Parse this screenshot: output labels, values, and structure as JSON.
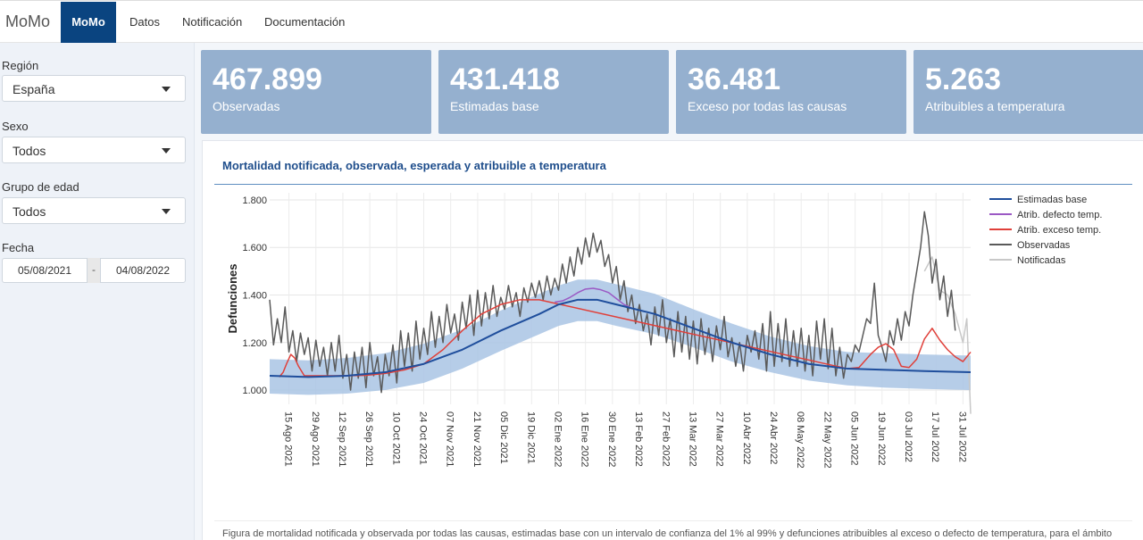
{
  "nav": {
    "brand": "MoMo",
    "items": [
      {
        "label": "MoMo",
        "active": true
      },
      {
        "label": "Datos",
        "active": false
      },
      {
        "label": "Notificación",
        "active": false
      },
      {
        "label": "Documentación",
        "active": false
      }
    ]
  },
  "sidebar": {
    "region_label": "Región",
    "region_value": "España",
    "sexo_label": "Sexo",
    "sexo_value": "Todos",
    "edad_label": "Grupo de edad",
    "edad_value": "Todos",
    "fecha_label": "Fecha",
    "fecha_start": "05/08/2021",
    "fecha_sep": "-",
    "fecha_end": "04/08/2022"
  },
  "value_boxes": [
    {
      "value": "467.899",
      "label": "Observadas",
      "color": "#95b0cf"
    },
    {
      "value": "431.418",
      "label": "Estimadas base",
      "color": "#95b0cf"
    },
    {
      "value": "36.481",
      "label": "Exceso por todas las causas",
      "color": "#95b0cf"
    },
    {
      "value": "5.263",
      "label": "Atribuibles a temperatura",
      "color": "#95b0cf"
    }
  ],
  "panel": {
    "title": "Mortalidad notificada, observada, esperada y atribuible a temperatura",
    "caption": "Figura de mortalidad notificada y observada por todas las causas, estimadas base con un intervalo de confianza del 1% al 99% y defunciones atribuibles al exceso o defecto de temperatura, para el ámbito"
  },
  "colors": {
    "nav_active": "#0a4480",
    "estimadas": "#1f4e9c",
    "band": "#a9c4e4",
    "defecto": "#9b59c4",
    "exceso": "#e0403a",
    "observadas": "#5a5a5a",
    "notificadas": "#c8c8c8"
  },
  "chart_data": {
    "type": "line",
    "ylabel": "Defunciones",
    "yticks": [
      "1.000",
      "1.200",
      "1.400",
      "1.600",
      "1.800"
    ],
    "ytick_values": [
      1000,
      1200,
      1400,
      1600,
      1800
    ],
    "ylim": [
      940,
      1830
    ],
    "x_tick_labels": [
      "15 Ago 2021",
      "29 Ago 2021",
      "12 Sep 2021",
      "26 Sep 2021",
      "10 Oct 2021",
      "24 Oct 2021",
      "07 Nov 2021",
      "21 Nov 2021",
      "05 Dic 2021",
      "19 Dic 2021",
      "02 Ene 2022",
      "16 Ene 2022",
      "30 Ene 2022",
      "13 Feb 2022",
      "27 Feb 2022",
      "13 Mar 2022",
      "27 Mar 2022",
      "10 Abr 2022",
      "24 Abr 2022",
      "08 May 2022",
      "22 May 2022",
      "05 Jun 2022",
      "19 Jun 2022",
      "03 Jul 2022",
      "17 Jul 2022",
      "31 Jul 2022"
    ],
    "x_tick_days": [
      10,
      24,
      38,
      52,
      66,
      80,
      94,
      108,
      122,
      136,
      150,
      164,
      178,
      192,
      206,
      220,
      234,
      248,
      262,
      276,
      290,
      304,
      318,
      332,
      346,
      360
    ],
    "x_range_days": [
      0,
      364
    ],
    "legend": [
      "Estimadas base",
      "Atrib. defecto temp.",
      "Atrib. exceso temp.",
      "Observadas",
      "Notificadas"
    ],
    "legend_position": "right",
    "grid": true,
    "series": [
      {
        "name": "Estimadas base",
        "day": [
          0,
          20,
          40,
          60,
          80,
          100,
          120,
          140,
          150,
          160,
          170,
          180,
          200,
          220,
          240,
          260,
          280,
          300,
          320,
          340,
          364
        ],
        "values": [
          1060,
          1055,
          1060,
          1075,
          1110,
          1170,
          1250,
          1320,
          1360,
          1380,
          1380,
          1360,
          1320,
          1260,
          1200,
          1150,
          1110,
          1090,
          1085,
          1080,
          1075
        ]
      },
      {
        "name": "Band low",
        "day": [
          0,
          20,
          40,
          60,
          80,
          100,
          120,
          140,
          150,
          160,
          170,
          180,
          200,
          220,
          240,
          260,
          280,
          300,
          320,
          340,
          364
        ],
        "values": [
          985,
          980,
          985,
          1000,
          1030,
          1090,
          1165,
          1235,
          1270,
          1290,
          1290,
          1270,
          1235,
          1180,
          1120,
          1075,
          1040,
          1020,
          1010,
          1005,
          1000
        ]
      },
      {
        "name": "Band high",
        "day": [
          0,
          20,
          40,
          60,
          80,
          100,
          120,
          140,
          150,
          160,
          170,
          180,
          200,
          220,
          240,
          260,
          280,
          300,
          320,
          340,
          364
        ],
        "values": [
          1130,
          1125,
          1135,
          1155,
          1195,
          1255,
          1335,
          1405,
          1440,
          1465,
          1465,
          1445,
          1405,
          1340,
          1280,
          1225,
          1185,
          1160,
          1155,
          1150,
          1145
        ]
      },
      {
        "name": "Atrib. exceso temp.",
        "day": [
          5,
          7,
          9,
          11,
          13,
          15,
          18,
          22,
          30,
          40,
          50,
          60,
          70,
          80,
          90,
          100,
          110,
          120,
          130,
          140,
          300,
          306,
          312,
          316,
          320,
          324,
          328,
          332,
          336,
          340,
          344,
          348,
          352,
          356,
          360,
          364
        ],
        "values": [
          1055,
          1075,
          1115,
          1150,
          1135,
          1100,
          1060,
          1060,
          1060,
          1060,
          1062,
          1070,
          1085,
          1110,
          1170,
          1250,
          1320,
          1360,
          1380,
          1380,
          1090,
          1095,
          1150,
          1180,
          1195,
          1170,
          1100,
          1095,
          1130,
          1215,
          1260,
          1210,
          1170,
          1140,
          1120,
          1160
        ]
      },
      {
        "name": "Atrib. defecto temp.",
        "day": [
          148,
          152,
          156,
          160,
          164,
          168,
          172,
          176,
          180,
          184,
          188
        ],
        "values": [
          1370,
          1375,
          1390,
          1410,
          1425,
          1428,
          1422,
          1410,
          1385,
          1360,
          1345
        ]
      },
      {
        "name": "Observadas",
        "day": [
          0,
          2,
          4,
          6,
          8,
          10,
          12,
          14,
          16,
          18,
          20,
          22,
          24,
          26,
          28,
          30,
          32,
          34,
          36,
          38,
          40,
          42,
          44,
          46,
          48,
          50,
          52,
          54,
          56,
          58,
          60,
          62,
          64,
          66,
          68,
          70,
          72,
          74,
          76,
          78,
          80,
          82,
          84,
          86,
          88,
          90,
          92,
          94,
          96,
          98,
          100,
          102,
          104,
          106,
          108,
          110,
          112,
          114,
          116,
          118,
          120,
          122,
          124,
          126,
          128,
          130,
          132,
          134,
          136,
          138,
          140,
          142,
          144,
          146,
          148,
          150,
          152,
          154,
          156,
          158,
          160,
          162,
          164,
          166,
          168,
          170,
          172,
          174,
          176,
          178,
          180,
          182,
          184,
          186,
          188,
          190,
          192,
          194,
          196,
          198,
          200,
          202,
          204,
          206,
          208,
          210,
          212,
          214,
          216,
          218,
          220,
          222,
          224,
          226,
          228,
          230,
          232,
          234,
          236,
          238,
          240,
          242,
          244,
          246,
          248,
          250,
          252,
          254,
          256,
          258,
          260,
          262,
          264,
          266,
          268,
          270,
          272,
          274,
          276,
          278,
          280,
          282,
          284,
          286,
          288,
          290,
          292,
          294,
          296,
          298,
          300,
          302,
          304,
          306,
          308,
          310,
          312,
          314,
          316,
          318,
          320,
          322,
          324,
          326,
          328,
          330,
          332,
          334,
          336,
          338,
          340,
          342,
          344,
          346,
          348,
          350,
          352,
          354,
          356,
          358,
          360,
          362,
          364
        ],
        "values": [
          1380,
          1190,
          1300,
          1200,
          1350,
          1160,
          1250,
          1120,
          1240,
          1150,
          1220,
          1080,
          1210,
          1100,
          1180,
          1060,
          1200,
          1080,
          1230,
          1050,
          1150,
          1000,
          1160,
          1050,
          1180,
          1010,
          1200,
          1060,
          1140,
          990,
          1150,
          1060,
          1190,
          1030,
          1250,
          1100,
          1240,
          1080,
          1290,
          1130,
          1260,
          1150,
          1330,
          1180,
          1310,
          1200,
          1360,
          1240,
          1320,
          1210,
          1370,
          1260,
          1400,
          1230,
          1420,
          1270,
          1410,
          1300,
          1440,
          1310,
          1390,
          1340,
          1440,
          1350,
          1410,
          1310,
          1430,
          1370,
          1450,
          1390,
          1460,
          1380,
          1480,
          1400,
          1470,
          1420,
          1530,
          1450,
          1560,
          1480,
          1600,
          1530,
          1640,
          1560,
          1660,
          1580,
          1630,
          1520,
          1570,
          1450,
          1520,
          1380,
          1460,
          1330,
          1400,
          1280,
          1360,
          1250,
          1320,
          1190,
          1350,
          1230,
          1380,
          1200,
          1300,
          1140,
          1330,
          1160,
          1310,
          1130,
          1290,
          1110,
          1300,
          1150,
          1260,
          1120,
          1270,
          1170,
          1310,
          1140,
          1220,
          1100,
          1200,
          1080,
          1230,
          1160,
          1250,
          1130,
          1280,
          1080,
          1330,
          1100,
          1280,
          1120,
          1300,
          1100,
          1250,
          1100,
          1260,
          1080,
          1230,
          1060,
          1290,
          1130,
          1300,
          1090,
          1260,
          1060,
          1180,
          1050,
          1150,
          1120,
          1190,
          1160,
          1230,
          1300,
          1280,
          1450,
          1230,
          1180,
          1120,
          1250,
          1190,
          1300,
          1210,
          1330,
          1270,
          1400,
          1500,
          1600,
          1750,
          1650,
          1450,
          1550,
          1380,
          1480,
          1310,
          1420,
          1250
        ]
      },
      {
        "name": "Notificadas",
        "day": [
          340,
          344,
          348,
          352,
          356,
          360,
          362,
          364
        ],
        "values": [
          1500,
          1560,
          1420,
          1400,
          1320,
          1200,
          1300,
          900
        ]
      }
    ]
  }
}
